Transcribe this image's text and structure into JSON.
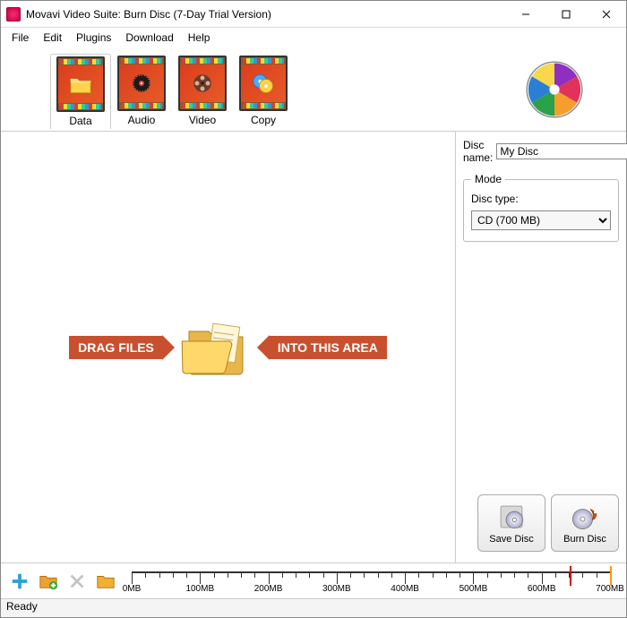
{
  "window": {
    "title": "Movavi Video Suite: Burn Disc (7-Day Trial Version)"
  },
  "menu": {
    "file": "File",
    "edit": "Edit",
    "plugins": "Plugins",
    "download": "Download",
    "help": "Help"
  },
  "tabs": {
    "data": "Data",
    "audio": "Audio",
    "video": "Video",
    "copy": "Copy",
    "active": "data"
  },
  "drop": {
    "left": "DRAG FILES",
    "right": "INTO THIS AREA"
  },
  "panel": {
    "disc_name_label": "Disc name:",
    "disc_name_value": "My Disc",
    "mode_legend": "Mode",
    "disc_type_label": "Disc type:",
    "disc_type_selected": "CD (700 MB)"
  },
  "buttons": {
    "save": "Save Disc",
    "burn": "Burn Disc"
  },
  "ruler": {
    "labels": [
      "0MB",
      "100MB",
      "200MB",
      "300MB",
      "400MB",
      "500MB",
      "600MB",
      "700MB"
    ],
    "marker_red_pct": 91.5,
    "marker_orange_pct": 100
  },
  "status": "Ready"
}
